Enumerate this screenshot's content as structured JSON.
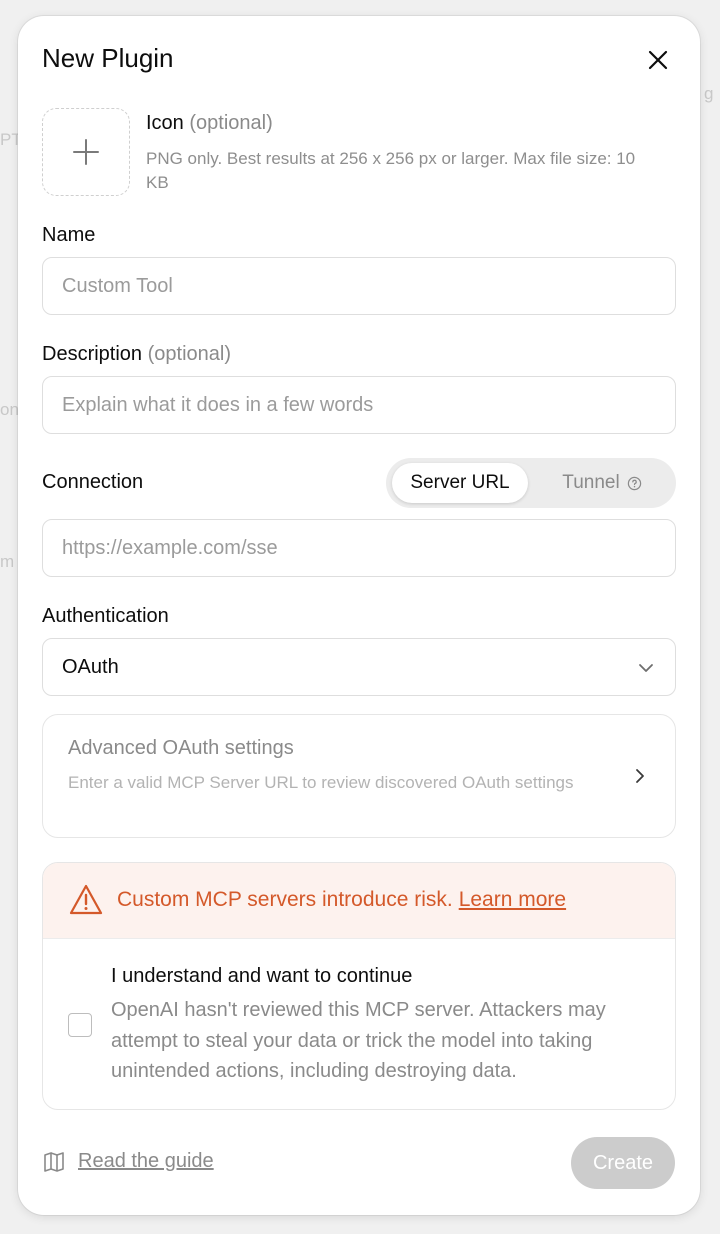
{
  "dialog": {
    "title": "New Plugin"
  },
  "icon_upload": {
    "label": "Icon",
    "optional": "(optional)",
    "help": "PNG only. Best results at 256 x 256 px or larger. Max file size: 10 KB"
  },
  "name": {
    "label": "Name",
    "placeholder": "Custom Tool",
    "value": ""
  },
  "description": {
    "label": "Description",
    "optional": "(optional)",
    "placeholder": "Explain what it does in a few words",
    "value": ""
  },
  "connection": {
    "label": "Connection",
    "options": [
      "Server URL",
      "Tunnel"
    ],
    "selected": "Server URL",
    "placeholder": "https://example.com/sse",
    "value": ""
  },
  "authentication": {
    "label": "Authentication",
    "selected": "OAuth"
  },
  "advanced": {
    "title": "Advanced OAuth settings",
    "subtitle": "Enter a valid MCP Server URL to review discovered OAuth settings"
  },
  "risk": {
    "warning": "Custom MCP servers introduce risk.",
    "link": "Learn more",
    "ack_title": "I understand and want to continue",
    "ack_body": "OpenAI hasn't reviewed this MCP server. Attackers may attempt to steal your data or trick the model into taking unintended actions, including destroying data.",
    "checked": false
  },
  "footer": {
    "guide_label": "Read the guide",
    "create_label": "Create"
  },
  "colors": {
    "warning": "#d4592a",
    "warning_bg": "#fdf2ee",
    "disabled_button": "#cccccc"
  }
}
